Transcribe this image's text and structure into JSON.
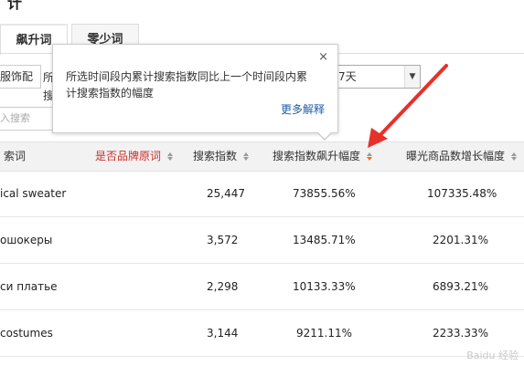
{
  "heading": "计",
  "tabs": [
    {
      "label": "飙升词",
      "active": true
    },
    {
      "label": "零少词",
      "active": false
    }
  ],
  "filters": {
    "category_select": "服饰配",
    "period_select": "7天",
    "search_placeholder": "入搜索"
  },
  "popover_behind": {
    "line1": "所",
    "line2": "搜"
  },
  "popover": {
    "text": "所选时间段内累计搜索指数同比上一个时间段内累计搜索指数的幅度",
    "close": "×",
    "more_link": "更多解释"
  },
  "table": {
    "headers": [
      {
        "label": "索词",
        "sortable": false
      },
      {
        "label": "是否品牌原词",
        "sortable": true,
        "color": "#c9302c"
      },
      {
        "label": "搜索指数",
        "sortable": true
      },
      {
        "label": "搜索指数飙升幅度",
        "sortable": true,
        "active": true
      },
      {
        "label": "曝光商品数增长幅度",
        "sortable": true
      }
    ],
    "rows": [
      {
        "keyword": "ical sweater",
        "brand": "",
        "index": "25,447",
        "growth": "73855.56%",
        "exposure": "107335.48%"
      },
      {
        "keyword": "ошокеры",
        "brand": "",
        "index": "3,572",
        "growth": "13485.71%",
        "exposure": "2201.31%"
      },
      {
        "keyword": "си платье",
        "brand": "",
        "index": "2,298",
        "growth": "10133.33%",
        "exposure": "6893.21%"
      },
      {
        "keyword": "costumes",
        "brand": "",
        "index": "3,144",
        "growth": "9211.11%",
        "exposure": "2233.33%"
      }
    ]
  },
  "colors": {
    "brand_header": "#c9302c",
    "active_sort": "#e07a1e",
    "annotation_arrow": "#e8302a",
    "link": "#1f5da8"
  },
  "watermark": "Baidu 经验"
}
